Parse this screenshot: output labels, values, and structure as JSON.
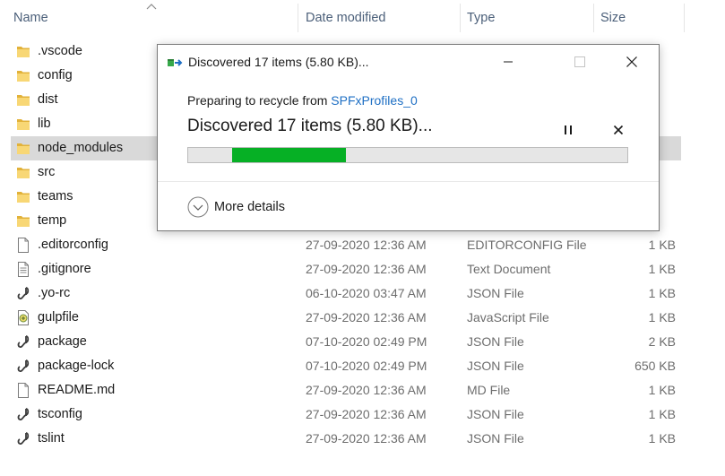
{
  "columns": {
    "name": "Name",
    "date": "Date modified",
    "type": "Type",
    "size": "Size"
  },
  "files": [
    {
      "name": ".vscode",
      "icon": "folder-icon",
      "date": "",
      "type": "",
      "size": ""
    },
    {
      "name": "config",
      "icon": "folder-icon",
      "date": "",
      "type": "",
      "size": ""
    },
    {
      "name": "dist",
      "icon": "folder-icon",
      "date": "",
      "type": "",
      "size": ""
    },
    {
      "name": "lib",
      "icon": "folder-icon",
      "date": "",
      "type": "",
      "size": ""
    },
    {
      "name": "node_modules",
      "icon": "folder-icon",
      "date": "",
      "type": "",
      "size": "",
      "selected": true
    },
    {
      "name": "src",
      "icon": "folder-icon",
      "date": "",
      "type": "",
      "size": ""
    },
    {
      "name": "teams",
      "icon": "folder-icon",
      "date": "",
      "type": "",
      "size": ""
    },
    {
      "name": "temp",
      "icon": "folder-icon",
      "date": "",
      "type": "",
      "size": ""
    },
    {
      "name": ".editorconfig",
      "icon": "blank-file-icon",
      "date": "27-09-2020 12:36 AM",
      "type": "EDITORCONFIG File",
      "size": "1 KB"
    },
    {
      "name": ".gitignore",
      "icon": "text-file-icon",
      "date": "27-09-2020 12:36 AM",
      "type": "Text Document",
      "size": "1 KB"
    },
    {
      "name": ".yo-rc",
      "icon": "json-file-icon",
      "date": "06-10-2020 03:47 AM",
      "type": "JSON File",
      "size": "1 KB"
    },
    {
      "name": "gulpfile",
      "icon": "script-file-icon",
      "date": "27-09-2020 12:36 AM",
      "type": "JavaScript File",
      "size": "1 KB"
    },
    {
      "name": "package",
      "icon": "json-file-icon",
      "date": "07-10-2020 02:49 PM",
      "type": "JSON File",
      "size": "2 KB"
    },
    {
      "name": "package-lock",
      "icon": "json-file-icon",
      "date": "07-10-2020 02:49 PM",
      "type": "JSON File",
      "size": "650 KB"
    },
    {
      "name": "README.md",
      "icon": "blank-file-icon",
      "date": "27-09-2020 12:36 AM",
      "type": "MD File",
      "size": "1 KB"
    },
    {
      "name": "tsconfig",
      "icon": "json-file-icon",
      "date": "27-09-2020 12:36 AM",
      "type": "JSON File",
      "size": "1 KB"
    },
    {
      "name": "tslint",
      "icon": "json-file-icon",
      "date": "27-09-2020 12:36 AM",
      "type": "JSON File",
      "size": "1 KB"
    }
  ],
  "dialog": {
    "title": "Discovered 17 items (5.80 KB)...",
    "prep_prefix": "Preparing to recycle from ",
    "prep_source": "SPFxProfiles_0",
    "status": "Discovered 17 items (5.80 KB)...",
    "progress_start": 0.1,
    "progress_end": 0.36,
    "more_details": "More details",
    "colors": {
      "progress": "#06b025",
      "link": "#1e6fc4"
    }
  }
}
